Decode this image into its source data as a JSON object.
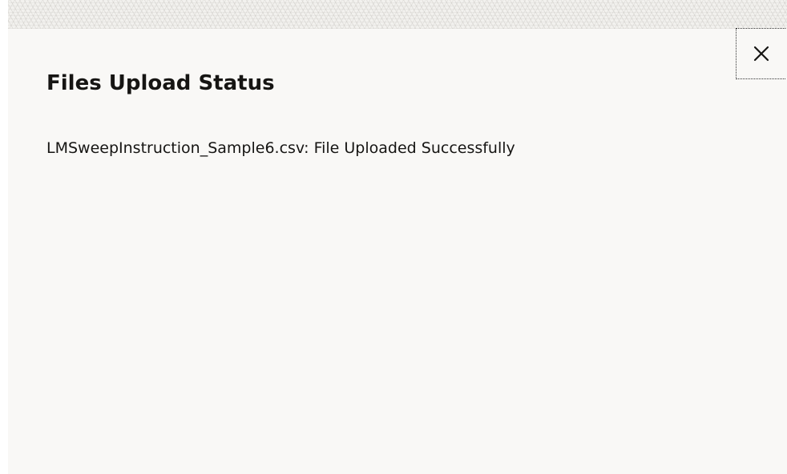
{
  "dialog": {
    "title": "Files Upload Status",
    "status_message": "LMSweepInstruction_Sample6.csv: File Uploaded Successfully",
    "close_icon": "close-icon"
  },
  "colors": {
    "dialog_background": "#f9f8f6",
    "text": "#161513",
    "header_strip": "#f2f1ee"
  }
}
